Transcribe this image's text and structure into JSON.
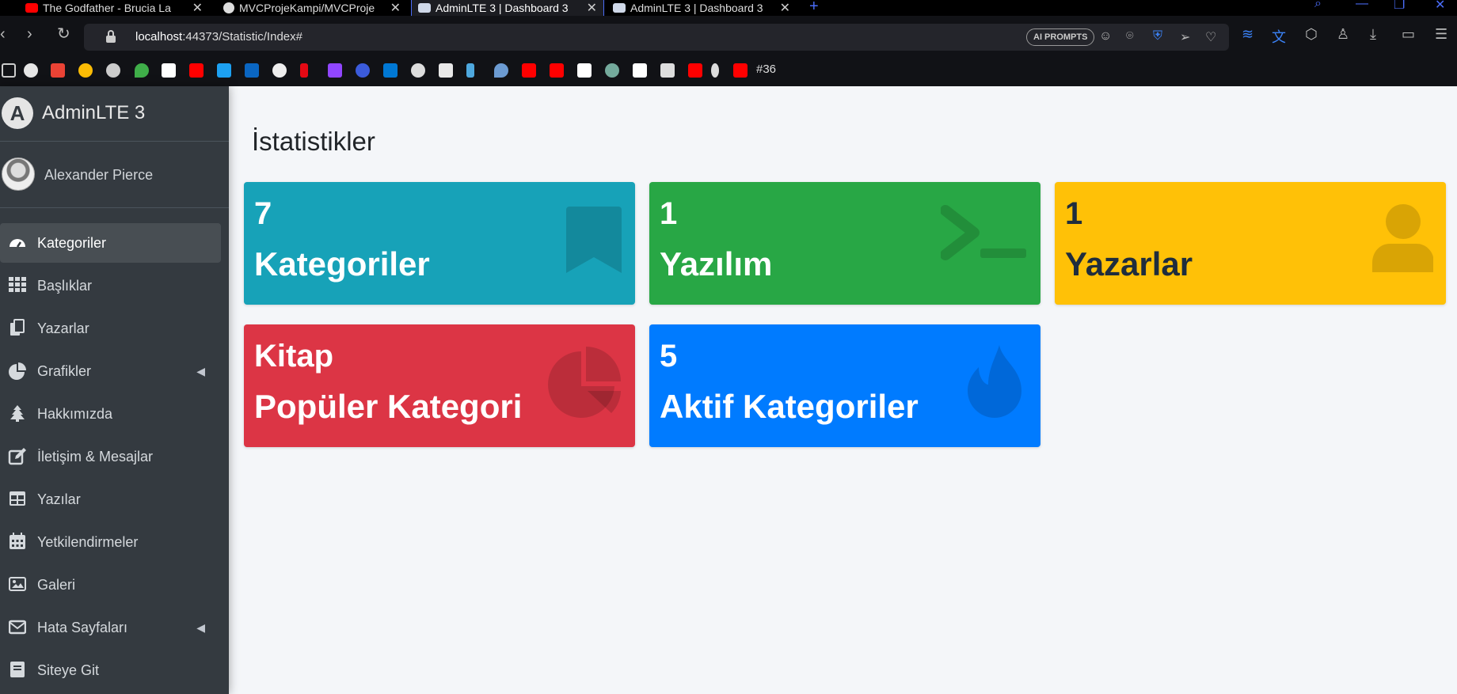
{
  "browser": {
    "tabs": [
      {
        "label": "The Godfather - Brucia La",
        "active": false
      },
      {
        "label": "MVCProjeKampi/MVCProje",
        "active": false
      },
      {
        "label": "AdminLTE 3 | Dashboard 3",
        "active": true
      },
      {
        "label": "AdminLTE 3 | Dashboard 3",
        "active": false
      }
    ],
    "url_host": "localhost",
    "url_path": ":44373/Statistic/Index#",
    "ai_prompts_label": "AI PROMPTS",
    "bookmark_counter": "#36"
  },
  "sidebar": {
    "brand": "AdminLTE 3",
    "brand_logo_letter": "A",
    "user_name": "Alexander Pierce",
    "items": [
      {
        "label": "Kategoriler",
        "icon": "tachometer-icon",
        "active": true
      },
      {
        "label": "Başlıklar",
        "icon": "th-icon"
      },
      {
        "label": "Yazarlar",
        "icon": "copy-icon"
      },
      {
        "label": "Grafikler",
        "icon": "chart-pie-icon",
        "has_children": true
      },
      {
        "label": "Hakkımızda",
        "icon": "tree-icon"
      },
      {
        "label": "İletişim & Mesajlar",
        "icon": "edit-icon"
      },
      {
        "label": "Yazılar",
        "icon": "table-icon"
      },
      {
        "label": "Yetkilendirmeler",
        "icon": "calendar-icon"
      },
      {
        "label": "Galeri",
        "icon": "image-icon"
      },
      {
        "label": "Hata Sayfaları",
        "icon": "envelope-icon",
        "has_children": true
      },
      {
        "label": "Siteye Git",
        "icon": "book-icon"
      }
    ]
  },
  "main": {
    "title": "İstatistikler",
    "boxes": [
      {
        "value": "7",
        "label": "Kategoriler",
        "color": "#17a2b8",
        "icon": "bookmark-icon"
      },
      {
        "value": "1",
        "label": "Yazılım",
        "color": "#28a745",
        "icon": "terminal-icon"
      },
      {
        "value": "1",
        "label": "Yazarlar",
        "color": "#ffc107",
        "icon": "user-icon"
      },
      {
        "value": "Kitap",
        "label": "Popüler Kategori",
        "color": "#dc3545",
        "icon": "chart-pie-icon"
      },
      {
        "value": "5",
        "label": "Aktif Kategoriler",
        "color": "#007bff",
        "icon": "fire-icon"
      }
    ]
  }
}
